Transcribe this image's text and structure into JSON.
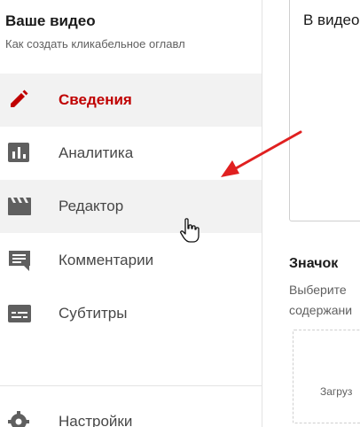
{
  "video": {
    "title": "Ваше видео",
    "subtitle": "Как создать кликабельное оглавл"
  },
  "nav": {
    "items": [
      {
        "label": "Сведения",
        "icon": "pencil-icon",
        "state": "active"
      },
      {
        "label": "Аналитика",
        "icon": "bar-chart-icon",
        "state": "normal"
      },
      {
        "label": "Редактор",
        "icon": "clapperboard-icon",
        "state": "hover"
      },
      {
        "label": "Комментарии",
        "icon": "comment-icon",
        "state": "normal"
      },
      {
        "label": "Субтитры",
        "icon": "subtitles-icon",
        "state": "normal"
      }
    ],
    "settings_label": "Настройки"
  },
  "main": {
    "description_text": "В видео",
    "thumbnail_title": "Значок",
    "thumbnail_desc_line1": "Выберите",
    "thumbnail_desc_line2": "содержани",
    "upload_label": "Загруз"
  },
  "colors": {
    "accent": "#c00000",
    "arrow": "#e02020",
    "icon_gray": "#5f5f5f",
    "active_bg": "#f2f2f2"
  }
}
